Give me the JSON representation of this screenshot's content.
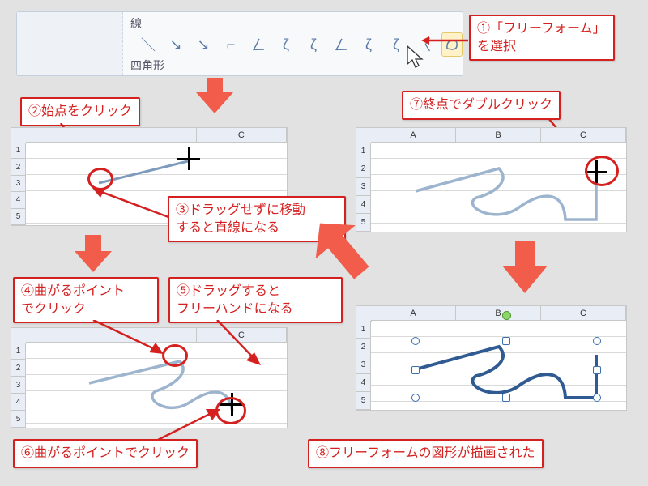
{
  "toolbar": {
    "section_lines": "線",
    "section_rects": "四角形",
    "tools": [
      "＼",
      "↘",
      "↘",
      "⌐",
      "ㄥ",
      "ζ",
      "ζ",
      "ㄥ",
      "ζ",
      "ζ",
      "〈",
      "△"
    ],
    "selected_index": 11
  },
  "steps": {
    "s1": "①「フリーフォーム」\nを選択",
    "s2": "②始点をクリック",
    "s3": "③ドラッグせずに移動\nすると直線になる",
    "s4": "④曲がるポイント\nでクリック",
    "s5": "⑤ドラッグすると\nフリーハンドになる",
    "s6": "⑥曲がるポイントでクリック",
    "s7": "⑦終点でダブルクリック",
    "s8": "⑧フリーフォームの図形が描画された"
  },
  "sheet": {
    "cols": [
      "A",
      "B",
      "C"
    ],
    "col_c": "C",
    "rows": [
      "1",
      "2",
      "3",
      "4",
      "5"
    ]
  }
}
